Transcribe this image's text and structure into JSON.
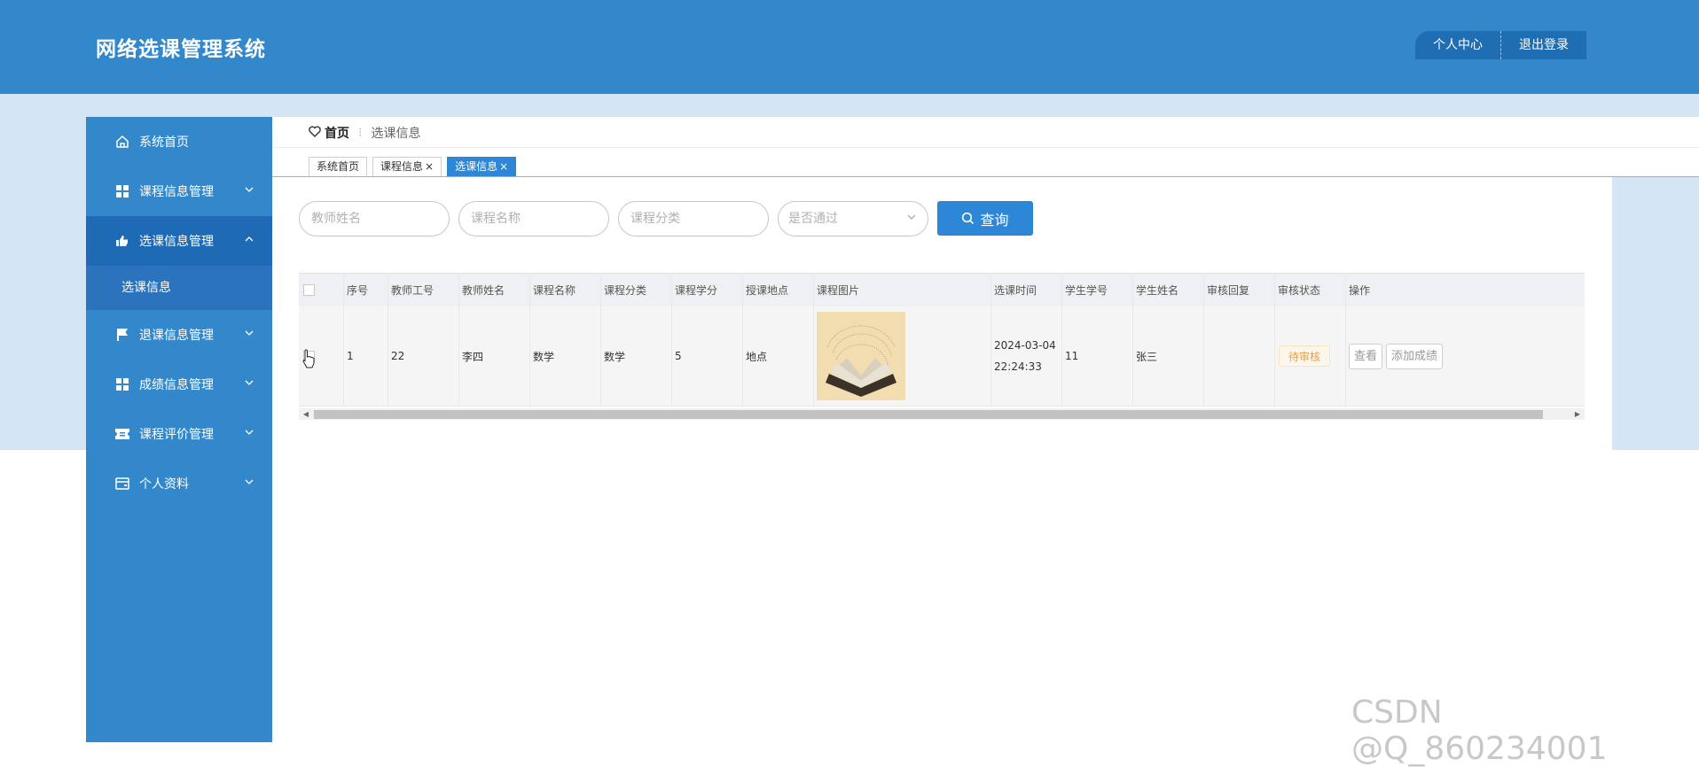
{
  "app": {
    "title": "网络选课管理系统"
  },
  "header": {
    "profile": "个人中心",
    "logout": "退出登录"
  },
  "sidebar": {
    "items": [
      {
        "label": "系统首页",
        "icon": "home-icon"
      },
      {
        "label": "课程信息管理",
        "icon": "grid-icon"
      },
      {
        "label": "选课信息管理",
        "icon": "thumb-icon",
        "sub": "选课信息"
      },
      {
        "label": "退课信息管理",
        "icon": "flag-icon"
      },
      {
        "label": "成绩信息管理",
        "icon": "grid-icon"
      },
      {
        "label": "课程评价管理",
        "icon": "ticket-icon"
      },
      {
        "label": "个人资料",
        "icon": "wallet-icon"
      }
    ]
  },
  "breadcrumb": {
    "home": "首页",
    "current": "选课信息"
  },
  "tabs": [
    {
      "label": "系统首页"
    },
    {
      "label": "课程信息"
    },
    {
      "label": "选课信息"
    }
  ],
  "search": {
    "teacher_placeholder": "教师姓名",
    "course_placeholder": "课程名称",
    "category_placeholder": "课程分类",
    "passed_placeholder": "是否通过",
    "query_label": "查询"
  },
  "table": {
    "columns": [
      "序号",
      "教师工号",
      "教师姓名",
      "课程名称",
      "课程分类",
      "课程学分",
      "授课地点",
      "课程图片",
      "选课时间",
      "学生学号",
      "学生姓名",
      "审核回复",
      "审核状态",
      "操作"
    ],
    "rows": [
      {
        "index": "1",
        "teacher_no": "22",
        "teacher_name": "李四",
        "course_name": "数学",
        "category": "数学",
        "credit": "5",
        "location": "地点",
        "time_date": "2024-03-04",
        "time_clock": "22:24:33",
        "student_no": "11",
        "student_name": "张三",
        "reply": "",
        "status": "待审核",
        "actions": {
          "view": "查看",
          "add_score": "添加成绩"
        }
      }
    ]
  },
  "watermark": "CSDN @Q_860234001",
  "colors": {
    "primary": "#3388cc",
    "accent": "#2d86d6",
    "band": "#d4e5f5",
    "pending": "#e6a23c"
  }
}
